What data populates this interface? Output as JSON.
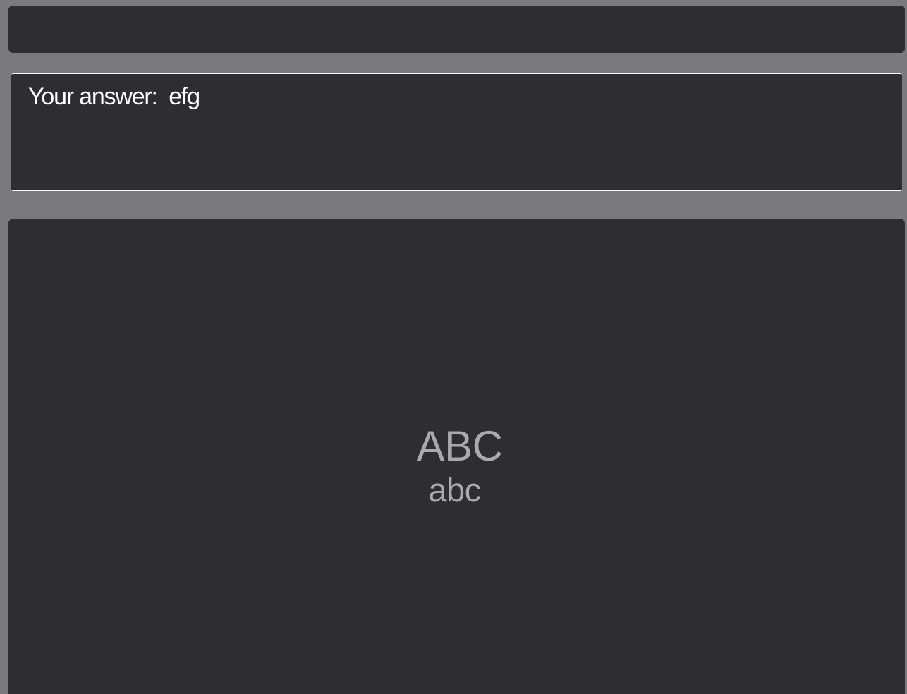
{
  "answer": {
    "label": "Your answer:",
    "value": "efg"
  },
  "card": {
    "front": "ABC",
    "back": "abc"
  },
  "colors": {
    "background": "#7a7b7f",
    "panel": "#2d2e33",
    "answer_text": "#ffffff",
    "card_text": "#a9aaae"
  }
}
